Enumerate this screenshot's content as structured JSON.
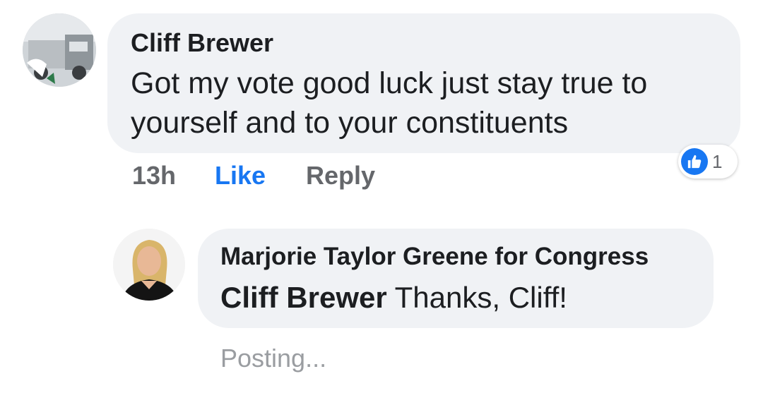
{
  "comment": {
    "author": "Cliff Brewer",
    "text_line1": "Got my vote good luck just stay true to",
    "text_line2": "yourself and to your constituents",
    "time": "13h",
    "like_label": "Like",
    "reply_label": "Reply",
    "reaction_count": "1",
    "reaction_icon": "thumbs-up-icon",
    "avatar_icon": "truck-avatar"
  },
  "reply": {
    "author": "Marjorie Taylor Greene for Congress",
    "mention": "Cliff Brewer",
    "text": "Thanks, Cliff!",
    "status": "Posting...",
    "avatar_icon": "woman-avatar"
  },
  "colors": {
    "bubble": "#f0f2f5",
    "text": "#1c1e21",
    "meta": "#65676b",
    "like_active": "#1877f2"
  }
}
